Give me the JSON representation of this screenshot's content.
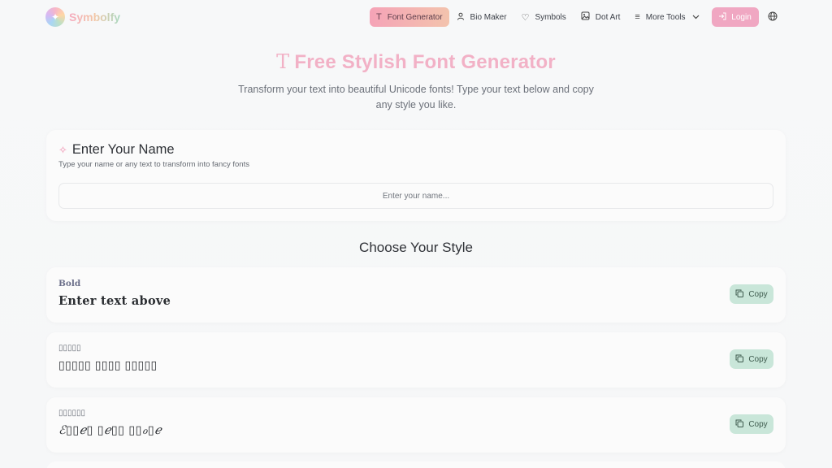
{
  "brand": {
    "name": "Symbolfy"
  },
  "nav": {
    "items": [
      {
        "label": "Font Generator",
        "icon": "text-t-icon",
        "active": true
      },
      {
        "label": "Bio Maker",
        "icon": "user-icon"
      },
      {
        "label": "Symbols",
        "icon": "heart-icon"
      },
      {
        "label": "Dot Art",
        "icon": "image-icon"
      },
      {
        "label": "More Tools",
        "icon": "menu-icon"
      }
    ],
    "login_label": "Login"
  },
  "hero": {
    "title": "Free Stylish Font Generator",
    "subtitle": "Transform your text into beautiful Unicode fonts! Type your text below and copy any style you like."
  },
  "input_card": {
    "title": "Enter Your Name",
    "description": "Type your name or any text to transform into fancy fonts",
    "placeholder": "Enter your name...",
    "value": ""
  },
  "styles_section": {
    "title": "Choose Your Style"
  },
  "styles": [
    {
      "label": "Bold",
      "preview": "Enter text above",
      "copy_label": "Copy"
    },
    {
      "label": "▯▯▯▯▯",
      "preview": "▯▯▯▯▯ ▯▯▯▯ ▯▯▯▯▯",
      "copy_label": "Copy"
    },
    {
      "label": "▯▯▯▯▯▯",
      "preview": "ℰ▯▯ℯ▯ ▯ℯ▯▯ ▯▯ℴ▯ℯ",
      "copy_label": "Copy"
    }
  ],
  "colors": {
    "accent_pink": "#f0a7c2",
    "title_pink": "#f2b1c6",
    "copy_green": "#c9e6d9"
  }
}
